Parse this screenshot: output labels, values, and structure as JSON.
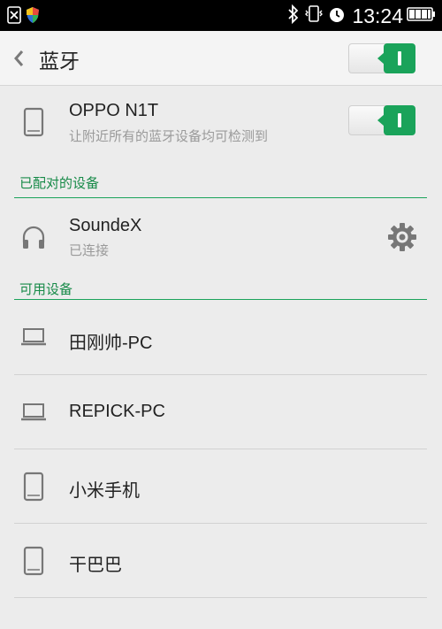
{
  "status_bar": {
    "time": "13:24",
    "icons": [
      "close-box-icon",
      "shield-icon",
      "bluetooth-icon",
      "vibrate-icon",
      "alarm-icon",
      "battery-icon"
    ]
  },
  "header": {
    "title": "蓝牙",
    "bluetooth_enabled": true
  },
  "this_device": {
    "name": "OPPO N1T",
    "subtitle": "让附近所有的蓝牙设备均可检测到",
    "visible": true
  },
  "paired_section": {
    "label": "已配对的设备",
    "devices": [
      {
        "name": "SoundeX",
        "status": "已连接",
        "icon": "headphones-icon"
      }
    ]
  },
  "available_section": {
    "label": "可用设备",
    "devices": [
      {
        "name": "田刚帅-PC",
        "icon": "laptop-icon"
      },
      {
        "name": "REPICK-PC",
        "icon": "laptop-icon"
      },
      {
        "name": "小米手机",
        "icon": "phone-icon"
      },
      {
        "name": "干巴巴",
        "icon": "phone-icon"
      }
    ]
  },
  "colors": {
    "accent": "#1aa35a",
    "background": "#ececec"
  }
}
